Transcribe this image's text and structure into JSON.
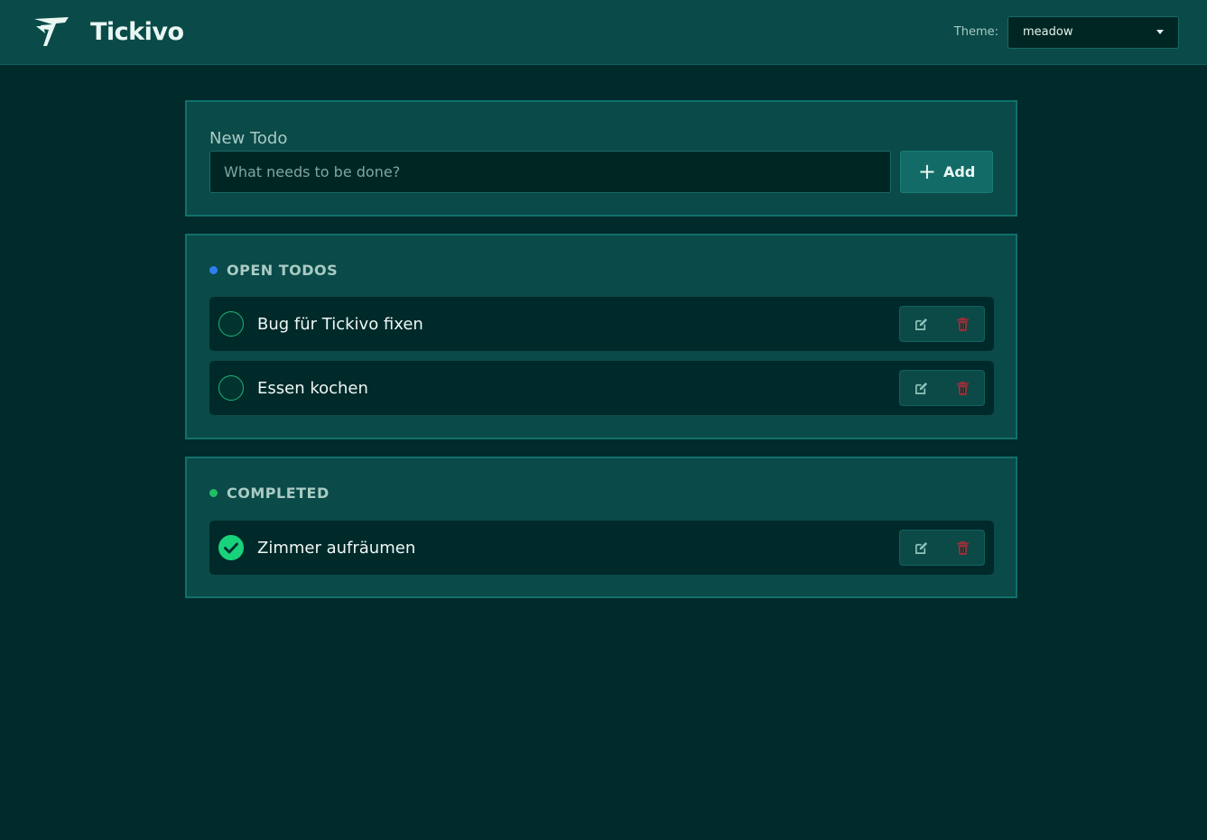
{
  "header": {
    "brand": "Tickivo",
    "logo_icon": "tickivo-logo-icon",
    "theme_label": "Theme:",
    "theme_value": "meadow"
  },
  "new_todo": {
    "label": "New Todo",
    "placeholder": "What needs to be done?",
    "value": "",
    "add_label": "Add",
    "add_icon": "plus-icon"
  },
  "open": {
    "title": "OPEN TODOS",
    "dot_color": "#2f7ef0",
    "items": [
      {
        "text": "Bug für Tickivo fixen",
        "done": false
      },
      {
        "text": "Essen kochen",
        "done": false
      }
    ]
  },
  "completed": {
    "title": "COMPLETED",
    "dot_color": "#1fbf63",
    "items": [
      {
        "text": "Zimmer aufräumen",
        "done": true
      }
    ]
  },
  "icons": {
    "edit": "edit-icon",
    "delete": "trash-icon",
    "check": "checkmark-icon"
  },
  "colors": {
    "accent": "#18d27c",
    "delete": "#9c2f36",
    "edit": "#8fc4b8"
  }
}
